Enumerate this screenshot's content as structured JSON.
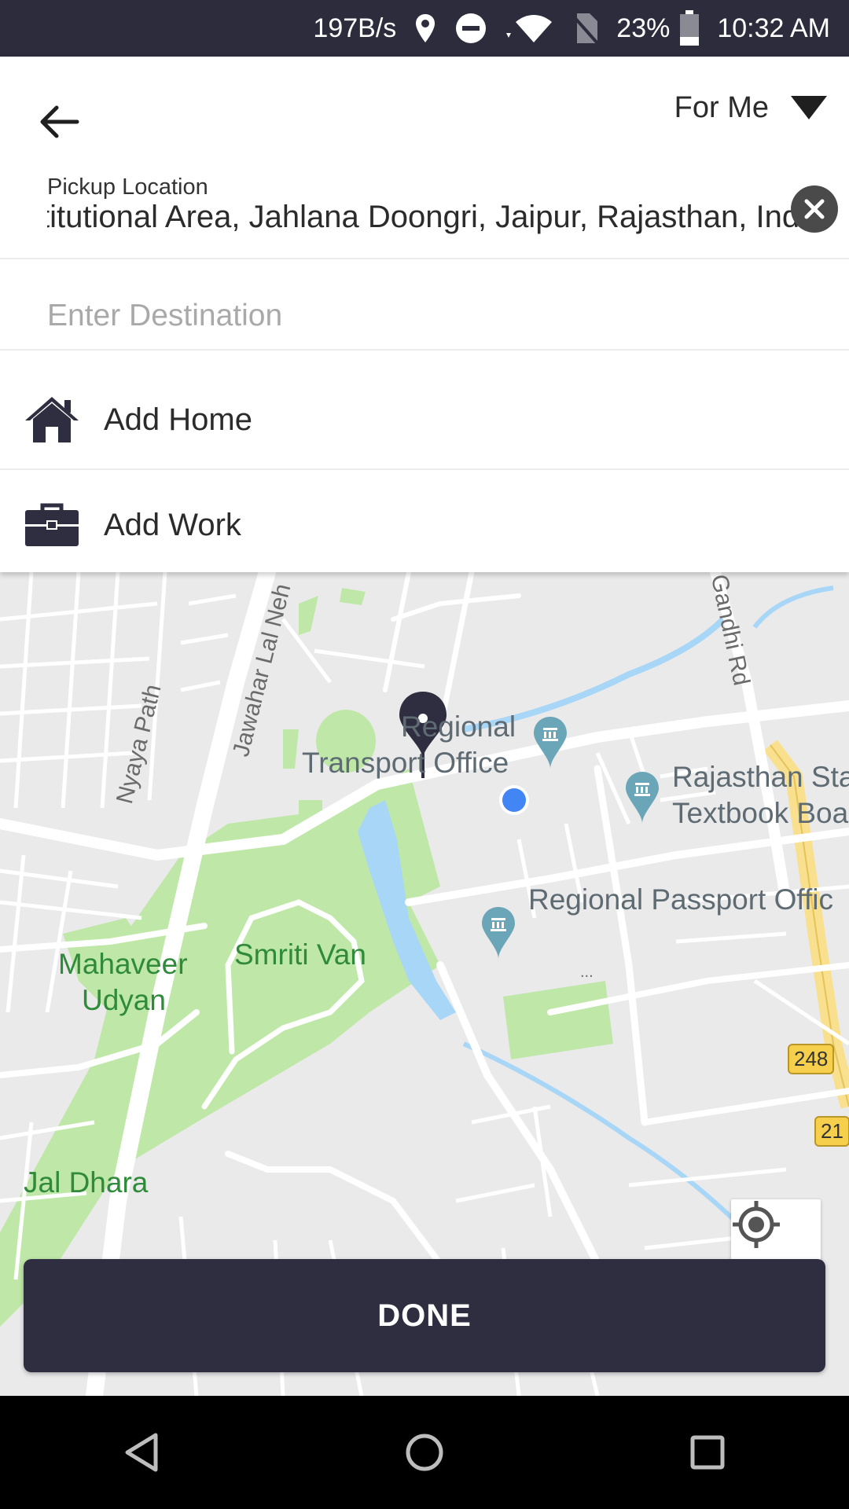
{
  "status_bar": {
    "net_speed": "197B/s",
    "battery": "23%",
    "time": "10:32 AM"
  },
  "header": {
    "rider_selector": "For Me"
  },
  "pickup": {
    "label": "Pickup Location",
    "value": "stitutional Area, Jahlana Doongri, Jaipur, Rajasthan, India"
  },
  "destination": {
    "placeholder": "Enter Destination",
    "value": ""
  },
  "saved_places": [
    {
      "label": "Add Home",
      "icon": "home-icon"
    },
    {
      "label": "Add Work",
      "icon": "briefcase-icon"
    }
  ],
  "map": {
    "places": {
      "rto_1": "Regional",
      "rto_2": "Transport Office",
      "textbook_1": "Rajasthan Sta",
      "textbook_2": "Textbook Boa",
      "passport": "Regional Passport Offic",
      "smriti_van": "Smriti Van",
      "mahaveer_1": "Mahaveer",
      "mahaveer_2": "Udyan",
      "jal_dhara": "Jal Dhara"
    },
    "roads": {
      "nyaya": "Nyaya Path",
      "jawahar": "Jawahar Lal Neh",
      "gandhi": "Gandhi Rd"
    },
    "shields": [
      "248",
      "21"
    ],
    "colors": {
      "park": "#bfe8a8",
      "water": "#a7d6f7",
      "road": "#ffffff",
      "highway": "#f8e08e",
      "user_dot": "#4285f4"
    }
  },
  "actions": {
    "done_label": "DONE"
  }
}
